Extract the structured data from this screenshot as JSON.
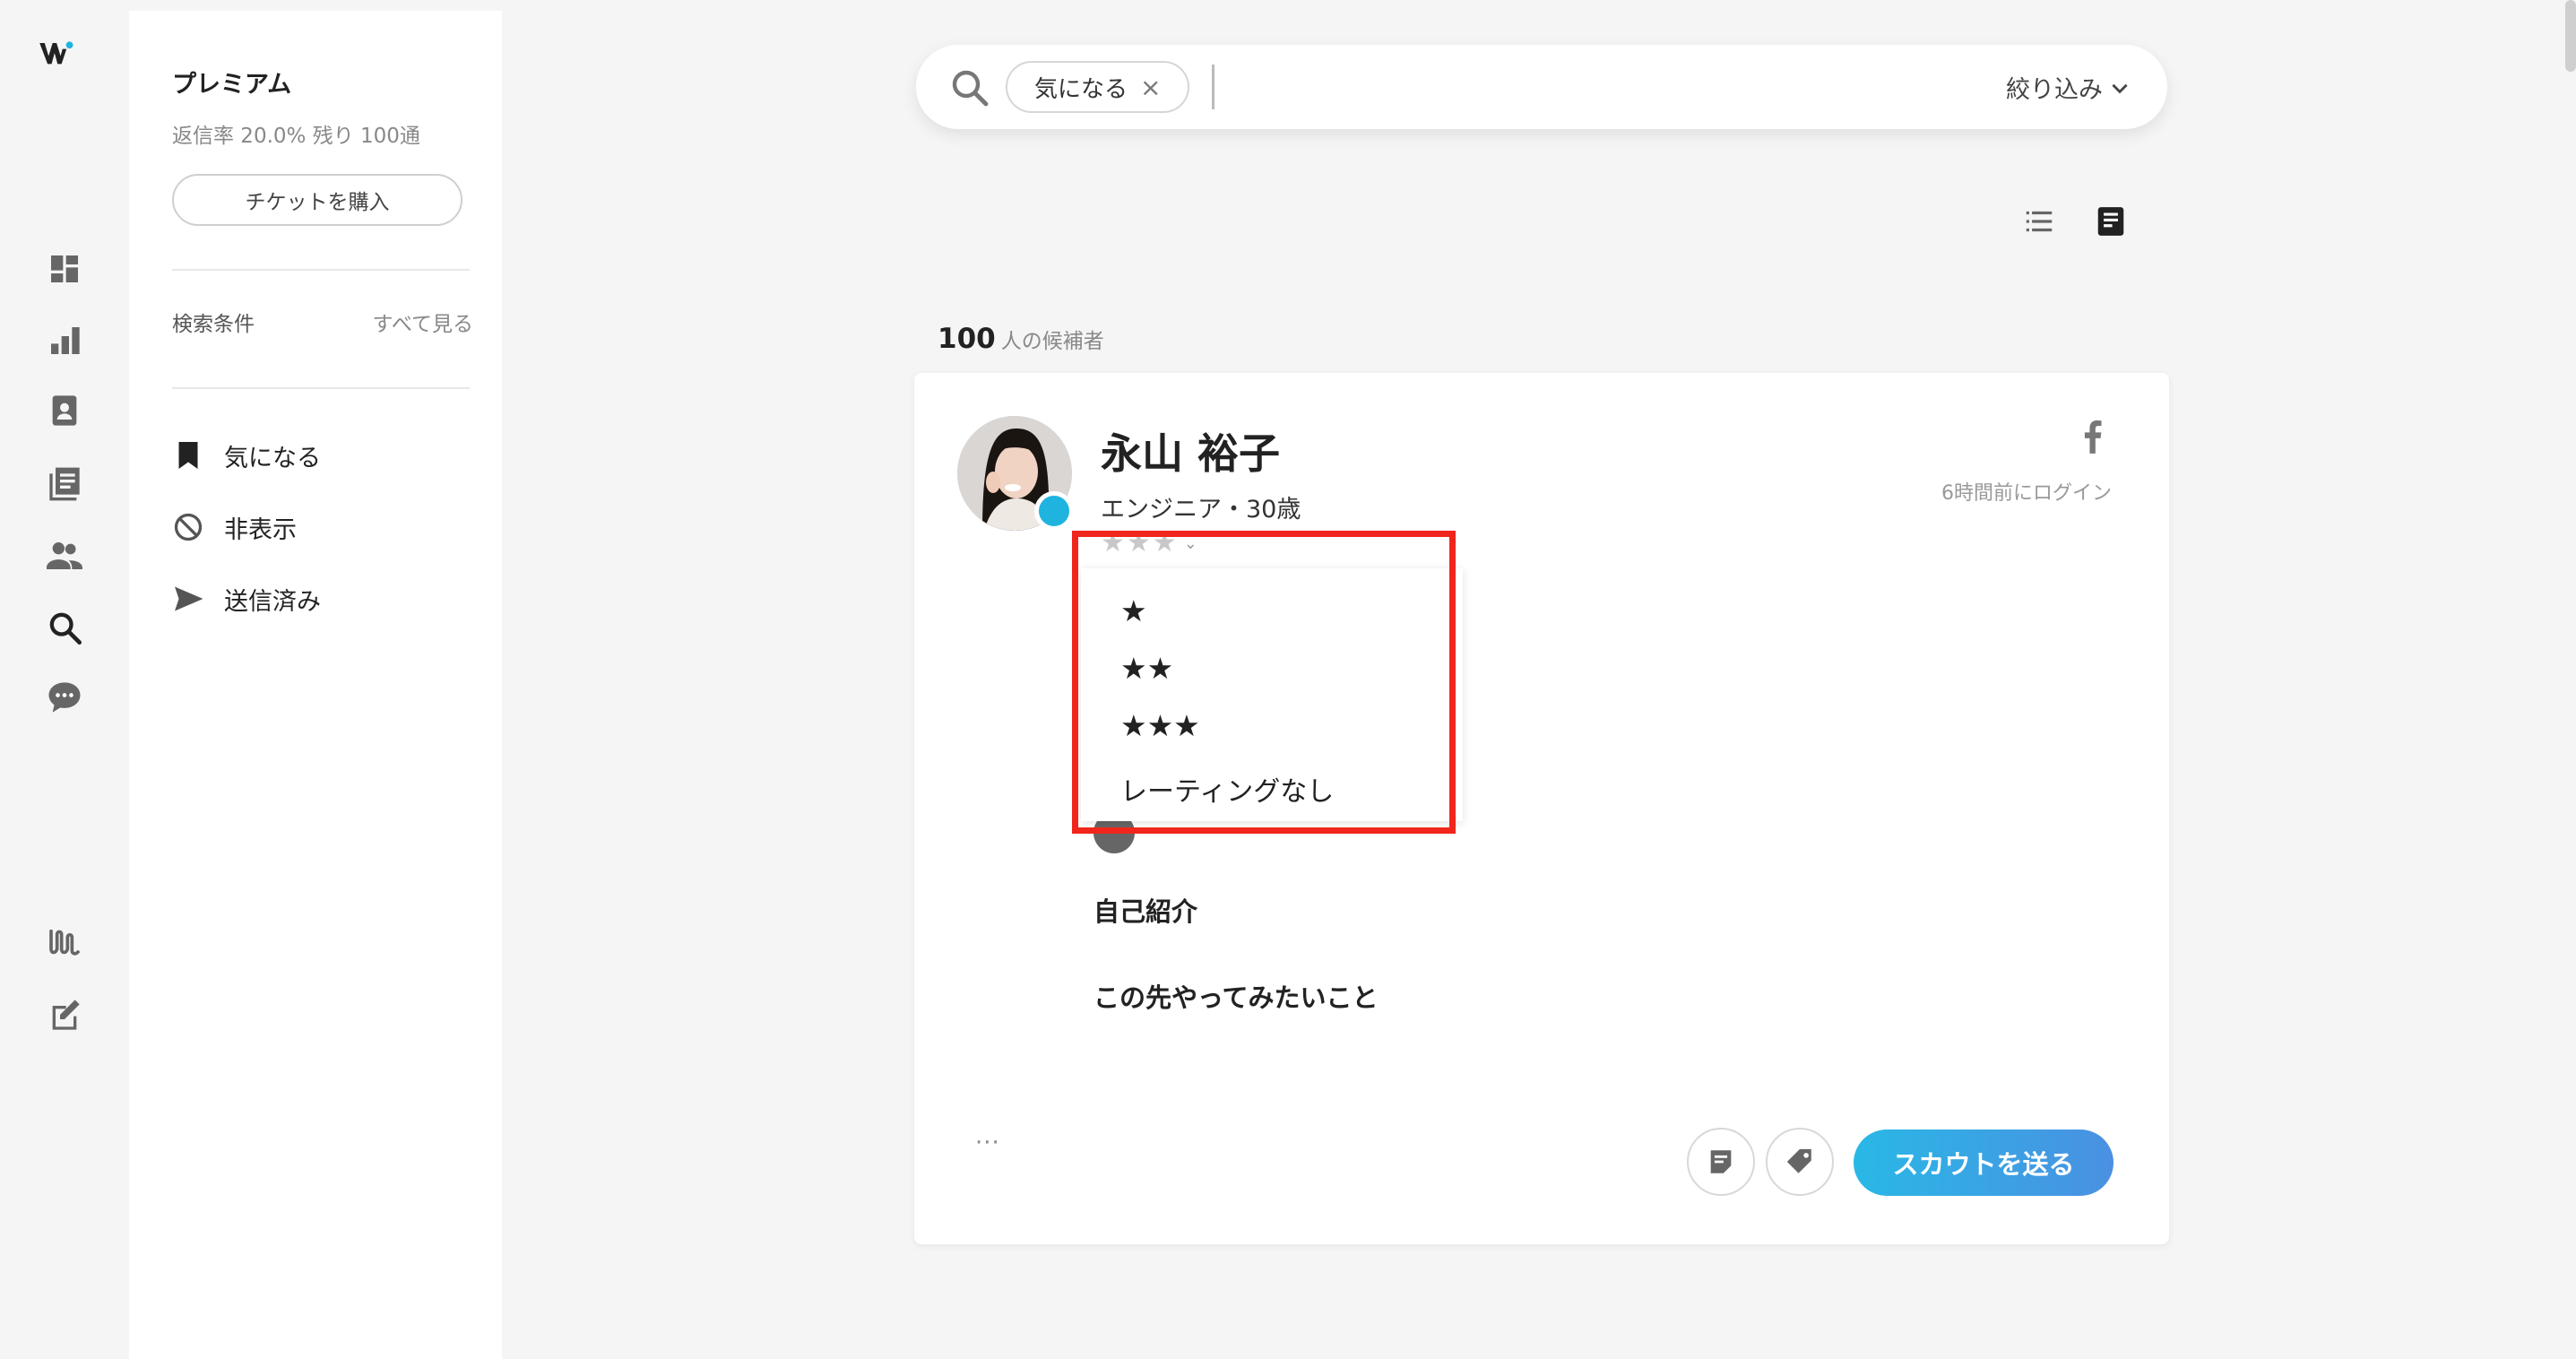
{
  "sidebar": {
    "icons": [
      "logo-icon",
      "dashboard-icon",
      "bar-chart-icon",
      "profile-card-icon",
      "list-icon",
      "people-icon",
      "search-icon",
      "chat-icon",
      "wantedly-mark-icon",
      "edit-icon"
    ]
  },
  "subpanel": {
    "plan": "プレミアム",
    "stats": "返信率 20.0%  残り 100通",
    "ticket_button": "チケットを購入",
    "conditions_label": "検索条件",
    "see_all": "すべて見る",
    "nav": [
      {
        "label": "気になる",
        "icon": "bookmark-icon"
      },
      {
        "label": "非表示",
        "icon": "block-icon"
      },
      {
        "label": "送信済み",
        "icon": "send-icon"
      }
    ]
  },
  "search": {
    "chip_label": "気になる",
    "chip_close": "×",
    "input_value": "",
    "filter_label": "絞り込み"
  },
  "results": {
    "count": "100",
    "count_label": "人の候補者"
  },
  "candidate": {
    "name": "永山 裕子",
    "role": "エンジニア・30歳",
    "last_login": "6時間前にログイン",
    "rating_display": "★★★",
    "rating_chevron": "⌄",
    "rating_options": [
      "★",
      "★★",
      "★★★",
      "レーティングなし"
    ],
    "intro_heading": "自己紹介",
    "future_heading": "この先やってみたいこと",
    "more": "···",
    "scout_button": "スカウトを送る"
  },
  "colors": {
    "accent_gradient_start": "#29b8e6",
    "accent_gradient_end": "#4a90e2",
    "online_dot": "#1fb4e0",
    "highlight_border": "#f0261c"
  }
}
